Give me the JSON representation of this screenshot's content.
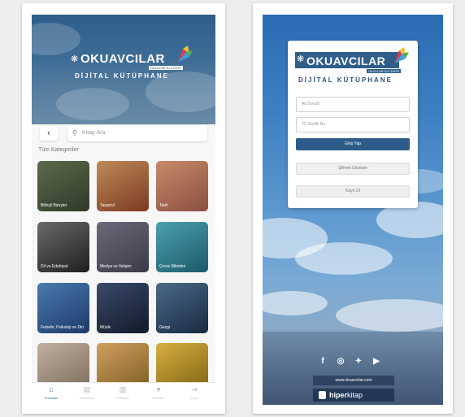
{
  "left": {
    "brand": "OKUAVCILAR",
    "brand_sub": "OKULLAR ELCİYESİ",
    "digital": "DİJİTAL KÜTÜPHANE",
    "search_placeholder": "Kitap Ara",
    "section_title": "Tüm Kategoriler",
    "tiles": [
      {
        "label": "Bilinçli Bireyler",
        "color1": "#5b6a4c",
        "color2": "#2f3a28"
      },
      {
        "label": "Tasarruf",
        "color1": "#c08a5a",
        "color2": "#7a3a20"
      },
      {
        "label": "Tarih",
        "color1": "#c88a6a",
        "color2": "#8a5040"
      },
      {
        "label": "Dil ve Edebiyat",
        "color1": "#6a6a6a",
        "color2": "#1f1f1f"
      },
      {
        "label": "Medya ve İletişim",
        "color1": "#6a6a7a",
        "color2": "#3a3a48"
      },
      {
        "label": "Çevre Bilimleri",
        "color1": "#4aa0b0",
        "color2": "#1d5a6a"
      },
      {
        "label": "Felsefe, Psikoloji ve Din",
        "color1": "#4a7ab0",
        "color2": "#1d3a6a"
      },
      {
        "label": "Müzik",
        "color1": "#3a4a6a",
        "color2": "#121a2a"
      },
      {
        "label": "Gezgi",
        "color1": "#4a6a8a",
        "color2": "#1a2a40"
      },
      {
        "label": "",
        "color1": "#c0b0a0",
        "color2": "#7a6a5a"
      },
      {
        "label": "",
        "color1": "#d0a060",
        "color2": "#7a5a20"
      },
      {
        "label": "",
        "color1": "#d8b040",
        "color2": "#7a6010"
      }
    ],
    "nav": [
      {
        "label": "Anasayfa",
        "icon": "home-icon",
        "glyph": "⌂"
      },
      {
        "label": "Kitaplarım",
        "icon": "book-icon",
        "glyph": "▤"
      },
      {
        "label": "Rafımda",
        "icon": "shelf-icon",
        "glyph": "▥"
      },
      {
        "label": "Favoriler",
        "icon": "heart-icon",
        "glyph": "♥"
      },
      {
        "label": "Çıkış",
        "icon": "logout-icon",
        "glyph": "⇥"
      }
    ]
  },
  "right": {
    "brand": "OKUAVCILAR",
    "brand_sub": "OKULLAR ELCİYESİ",
    "digital": "DİJİTAL KÜTÜPHANE",
    "name_placeholder": "Ad Soyad",
    "id_placeholder": "TC Kimlik No",
    "login_label": "Giriş Yap",
    "btn2_label": "Şifremi Unuttum",
    "btn3_label": "Kayıt Ol",
    "url": "www.okuavcilar.com",
    "hiper_bold": "hiper",
    "hiper_rest": "kitap"
  },
  "colors": {
    "accent": "#2d5c8b",
    "active_nav": "#3a6ea5"
  }
}
